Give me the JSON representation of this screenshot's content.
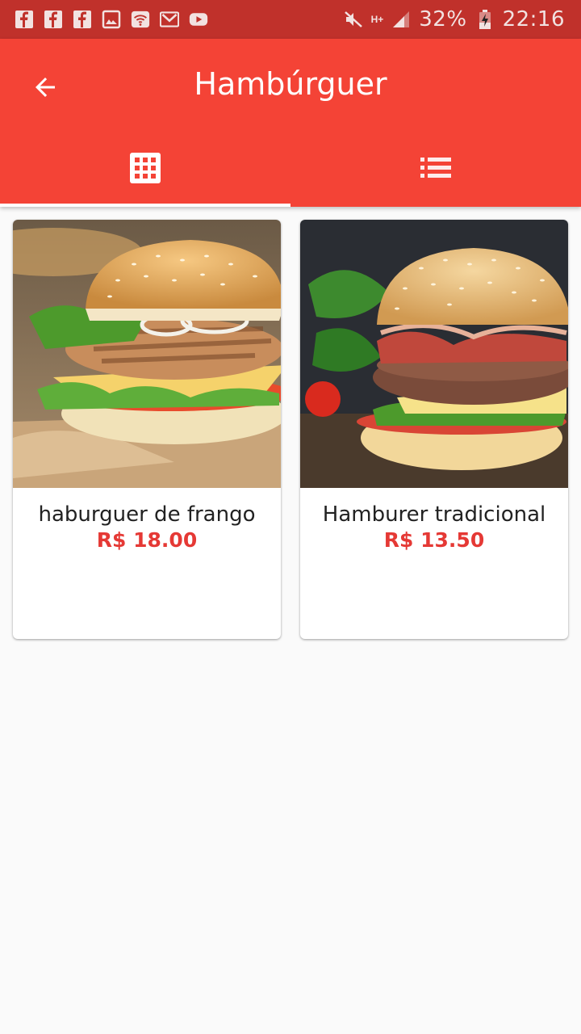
{
  "status_bar": {
    "notification_icons": [
      "facebook-icon",
      "facebook-icon",
      "facebook-icon",
      "gallery-icon",
      "wifi-icon",
      "gmail-icon",
      "youtube-icon"
    ],
    "battery": "32%",
    "time": "22:16",
    "network": "H+"
  },
  "app_bar": {
    "title": "Hambúrguer",
    "back_icon": "arrow-back-icon",
    "tabs": [
      {
        "icon": "grid-view-icon",
        "selected": true
      },
      {
        "icon": "list-view-icon",
        "selected": false
      }
    ]
  },
  "colors": {
    "primary": "#f44336",
    "status_bar": "#c0312b",
    "price": "#e53935"
  },
  "products": [
    {
      "name": "haburguer de frango",
      "price": "R$ 18.00",
      "image": "chicken-burger-photo"
    },
    {
      "name": "Hamburer tradicional",
      "price": "R$ 13.50",
      "image": "beef-bacon-burger-photo"
    }
  ]
}
